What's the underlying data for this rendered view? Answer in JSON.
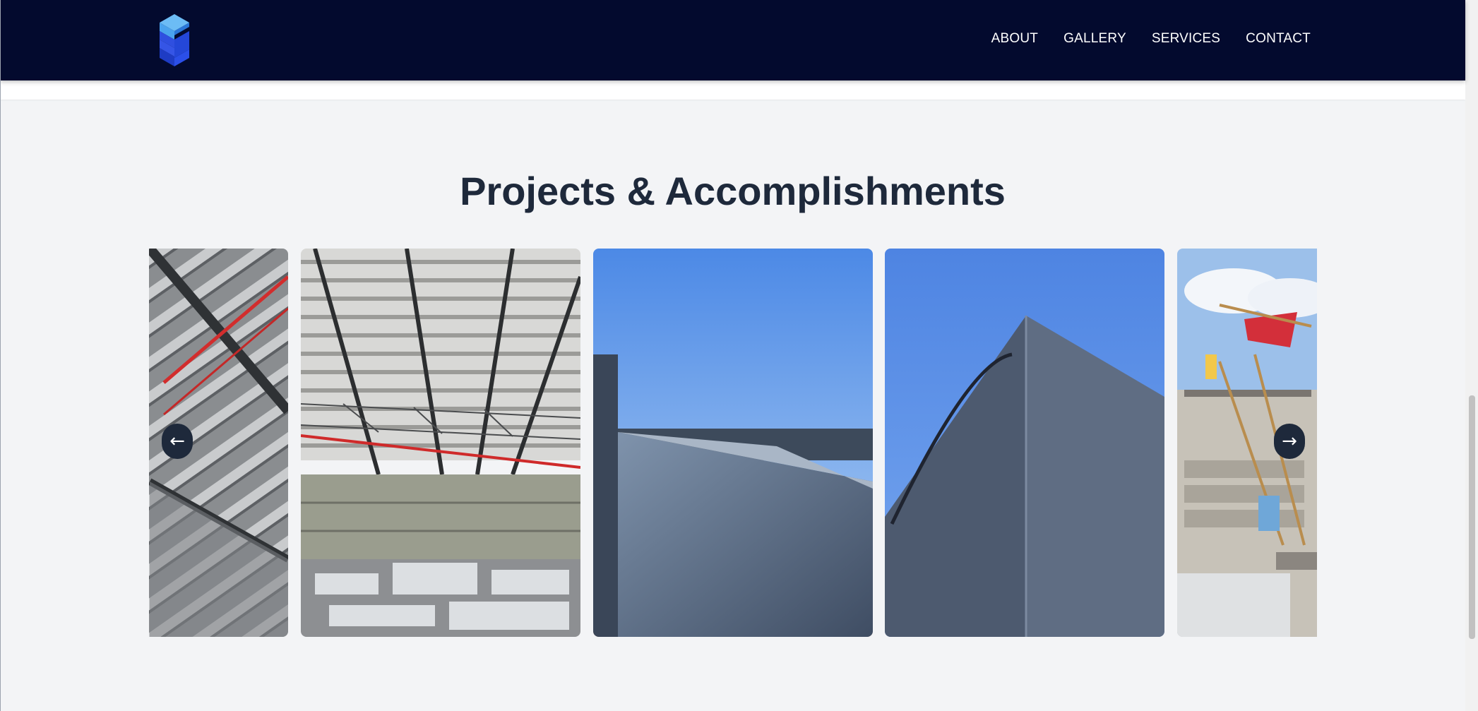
{
  "navbar": {
    "logo_alt": "Company logo",
    "links": [
      {
        "label": "ABOUT"
      },
      {
        "label": "GALLERY"
      },
      {
        "label": "SERVICES"
      },
      {
        "label": "CONTACT"
      }
    ]
  },
  "section": {
    "title": "Projects & Accomplishments"
  },
  "carousel": {
    "prev_label": "←",
    "next_label": "→",
    "slides": [
      {
        "subject": "steel roof framing"
      },
      {
        "subject": "warehouse steel truss interior"
      },
      {
        "subject": "concrete parapet wall against sky"
      },
      {
        "subject": "concrete wall corner"
      },
      {
        "subject": "workers on scaffolding"
      }
    ]
  },
  "colors": {
    "navbar_bg": "#030a2e",
    "page_bg": "#f3f4f6",
    "title": "#1e293b",
    "arrow_bg": "#1e293b",
    "logo_primary": "#2f4fe0",
    "logo_light": "#4aa3ee"
  }
}
